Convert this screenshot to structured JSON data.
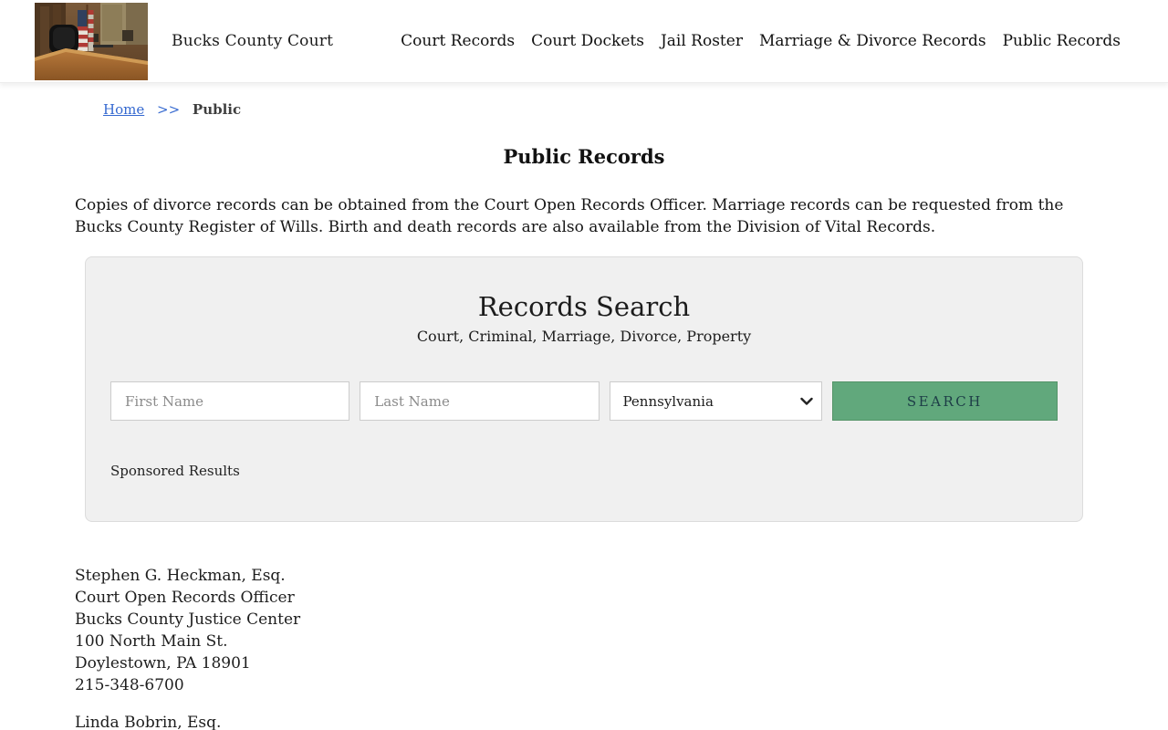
{
  "header": {
    "site_title": "Bucks County Court",
    "nav": [
      {
        "label": "Court Records"
      },
      {
        "label": "Court Dockets"
      },
      {
        "label": "Jail Roster"
      },
      {
        "label": "Marriage & Divorce Records"
      },
      {
        "label": "Public Records"
      }
    ]
  },
  "breadcrumb": {
    "home": "Home",
    "separator": ">>",
    "current": "Public"
  },
  "page": {
    "title": "Public Records",
    "intro": "Copies of divorce records can be obtained from the Court Open Records Officer. Marriage records can be requested from the Bucks County Register of Wills. Birth and death records are also available from the Division of Vital Records."
  },
  "search_panel": {
    "title": "Records Search",
    "subtitle": "Court, Criminal, Marriage, Divorce, Property",
    "first_name_placeholder": "First Name",
    "last_name_placeholder": "Last Name",
    "state_selected": "Pennsylvania",
    "search_button_label": "SEARCH",
    "sponsored_label": "Sponsored Results",
    "colors": {
      "button_green": "#61a87c",
      "panel_background": "#f0f0f0",
      "link_blue": "#3569d0"
    }
  },
  "contacts": [
    {
      "lines": [
        "Stephen G. Heckman, Esq.",
        "Court Open Records Officer",
        "Bucks County Justice Center",
        "100 North Main St.",
        "Doylestown, PA 18901",
        "215-348-6700"
      ]
    },
    {
      "lines": [
        "Linda Bobrin, Esq."
      ]
    }
  ]
}
